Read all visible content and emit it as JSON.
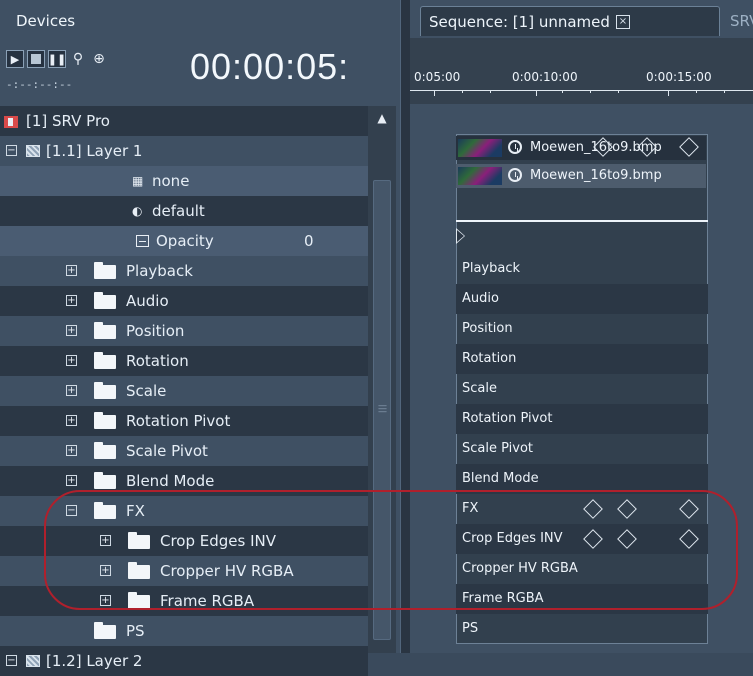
{
  "left_panel": {
    "tab_label": "Devices",
    "timecode_small": "-:--:--:--",
    "timecode_big": "00:00:05:",
    "device": {
      "label": "[1] SRV Pro"
    },
    "layer1": {
      "label": "[1.1] Layer 1"
    },
    "props": [
      {
        "label": "none",
        "icon": "clip-icon"
      },
      {
        "label": "default",
        "icon": "effect-icon"
      },
      {
        "label": "Opacity",
        "value": "0",
        "icon": "opacity-icon"
      }
    ],
    "groups": [
      {
        "label": "Playback"
      },
      {
        "label": "Audio"
      },
      {
        "label": "Position"
      },
      {
        "label": "Rotation"
      },
      {
        "label": "Scale"
      },
      {
        "label": "Rotation Pivot"
      },
      {
        "label": "Scale Pivot"
      },
      {
        "label": "Blend Mode"
      }
    ],
    "fx": {
      "label": "FX",
      "children": [
        {
          "label": "Crop Edges INV"
        },
        {
          "label": "Cropper HV RGBA"
        },
        {
          "label": "Frame RGBA"
        }
      ]
    },
    "ps": {
      "label": "PS"
    },
    "layer2": {
      "label": "[1.2] Layer 2"
    }
  },
  "right_panel": {
    "tab_label": "Sequence: [1] unnamed",
    "tab2_label": "SRV",
    "ruler": [
      "0:05:00",
      "0:00:10:00",
      "0:00:15:00"
    ],
    "clips": [
      {
        "label": "Moewen_16to9.bmp"
      },
      {
        "label": "Moewen_16to9.bmp"
      }
    ],
    "rows": [
      "Playback",
      "Audio",
      "Position",
      "Rotation",
      "Scale",
      "Rotation Pivot",
      "Scale Pivot",
      "Blend Mode",
      "FX",
      "Crop Edges INV",
      "Cropper HV RGBA",
      "Frame RGBA",
      "PS"
    ]
  },
  "colors": {
    "background": "#3f5063",
    "row_dark": "#2b3745",
    "highlight": "#b0202c"
  }
}
